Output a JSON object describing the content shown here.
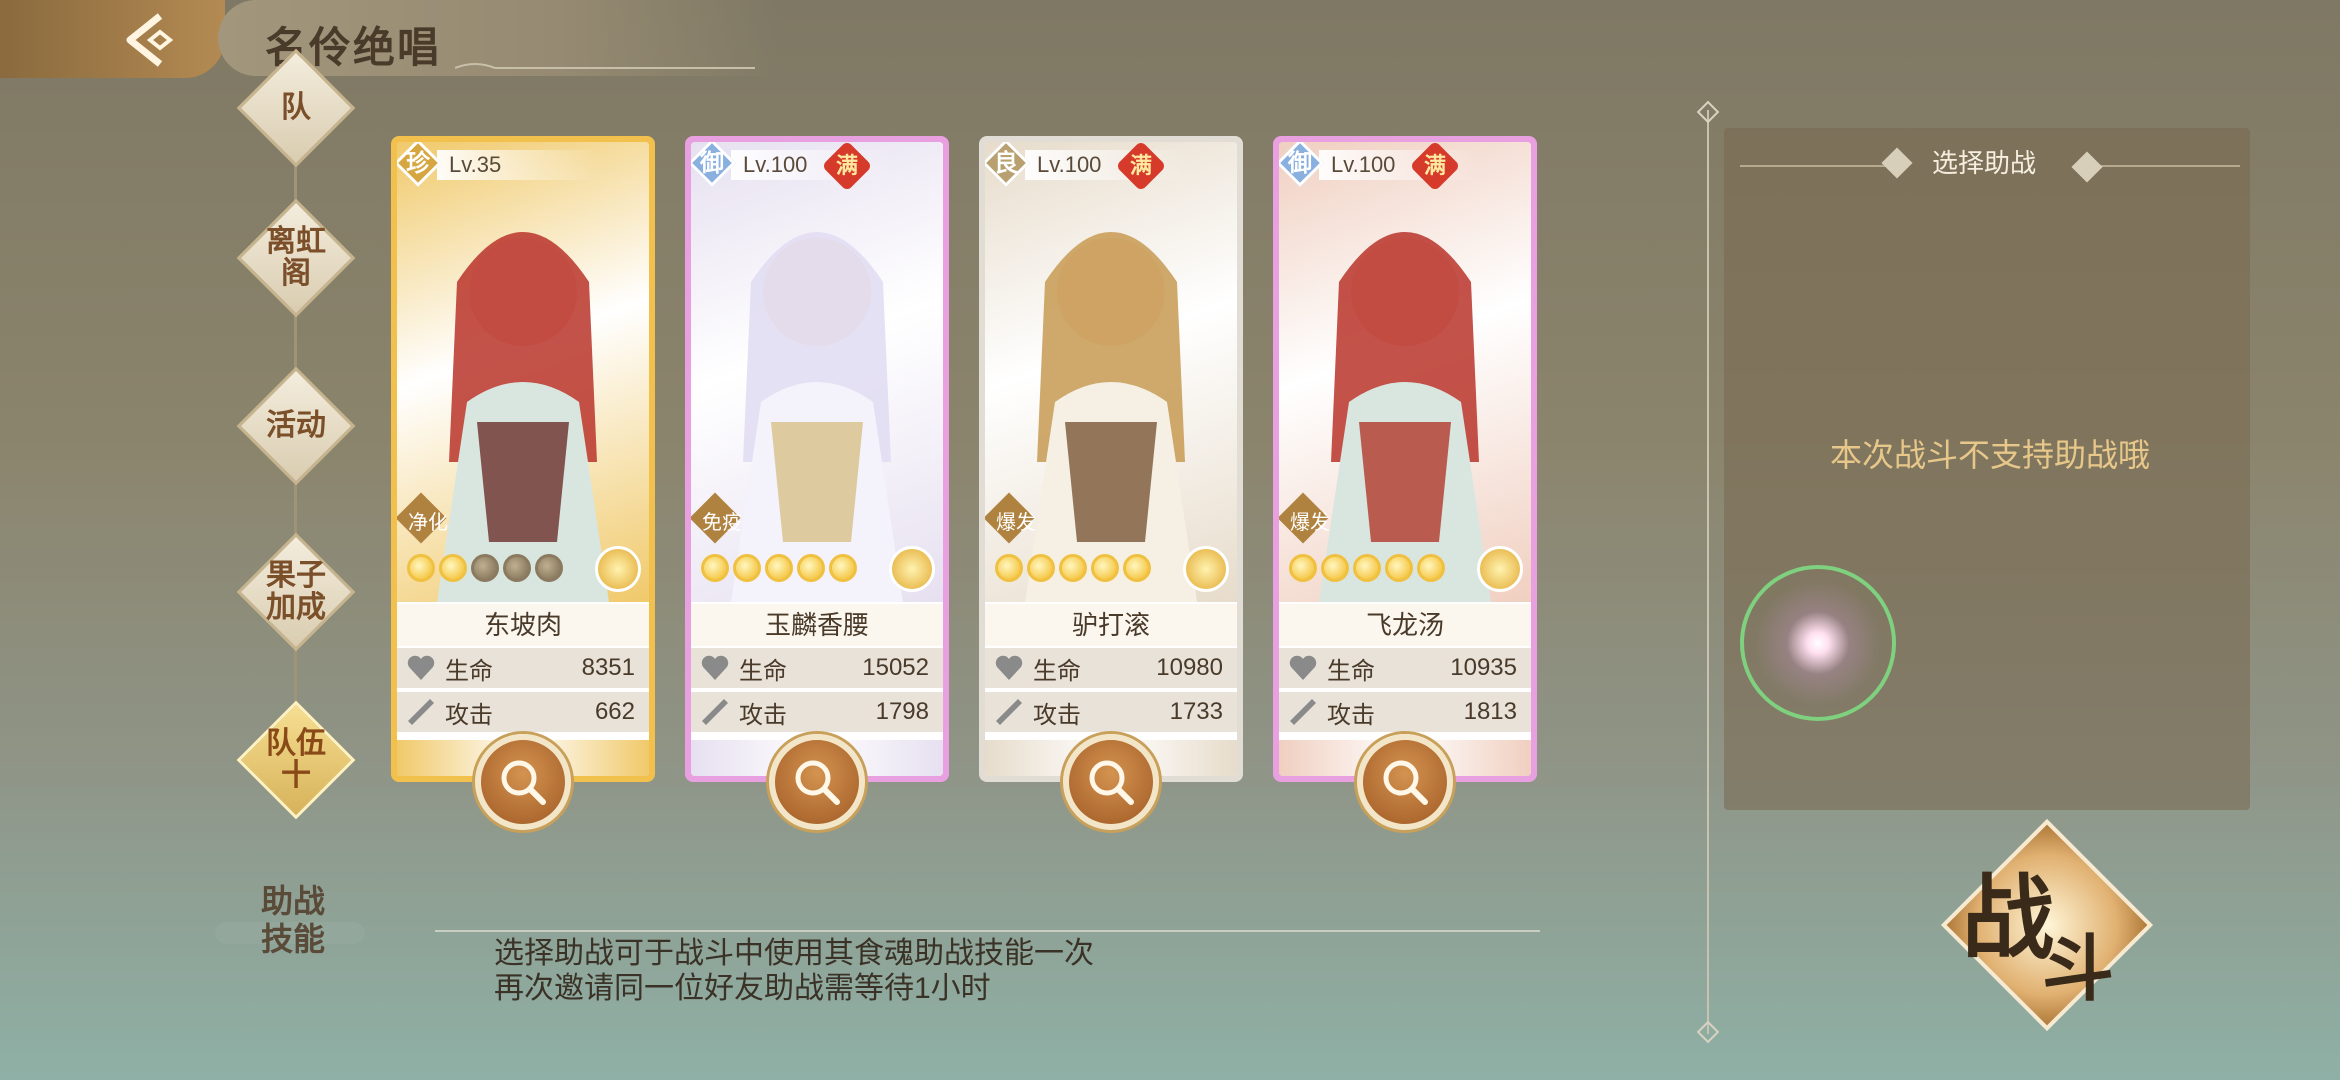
{
  "header": {
    "title": "名伶绝唱"
  },
  "menu": {
    "items": [
      {
        "label": "队",
        "active": false
      },
      {
        "label": "离虹\n阁",
        "active": false
      },
      {
        "label": "活动",
        "active": false
      },
      {
        "label": "果子\n加成",
        "active": false
      },
      {
        "label": "队伍\n十",
        "active": true
      }
    ]
  },
  "stat_labels": {
    "hp": "生命",
    "atk": "攻击"
  },
  "cards": [
    {
      "rank": "珍",
      "level": "Lv.35",
      "full": "",
      "skill": "净化",
      "name": "东坡肉",
      "hp": "8351",
      "atk": "662",
      "stars": 2,
      "frame": "#f2c04c",
      "bg": "#f0c96a"
    },
    {
      "rank": "御",
      "level": "Lv.100",
      "full": "满",
      "skill": "免疫",
      "name": "玉麟香腰",
      "hp": "15052",
      "atk": "1798",
      "stars": 5,
      "frame": "#e8a0e0",
      "bg": "#e6e0f0"
    },
    {
      "rank": "良",
      "level": "Lv.100",
      "full": "满",
      "skill": "爆发",
      "name": "驴打滚",
      "hp": "10980",
      "atk": "1733",
      "stars": 5,
      "frame": "#e2ddd4",
      "bg": "#e7dccb"
    },
    {
      "rank": "御",
      "level": "Lv.100",
      "full": "满",
      "skill": "爆发",
      "name": "飞龙汤",
      "hp": "10935",
      "atk": "1813",
      "stars": 5,
      "frame": "#e8a0e0",
      "bg": "#f0cfc0"
    }
  ],
  "help": {
    "title": "助战\n技能",
    "line1": "选择助战可于战斗中使用其食魂助战技能一次",
    "line2": "再次邀请同一位好友助战需等待1小时"
  },
  "assist": {
    "title": "选择助战",
    "message": "本次战斗不支持助战哦"
  },
  "battle": {
    "char1": "战",
    "char2": "斗"
  }
}
